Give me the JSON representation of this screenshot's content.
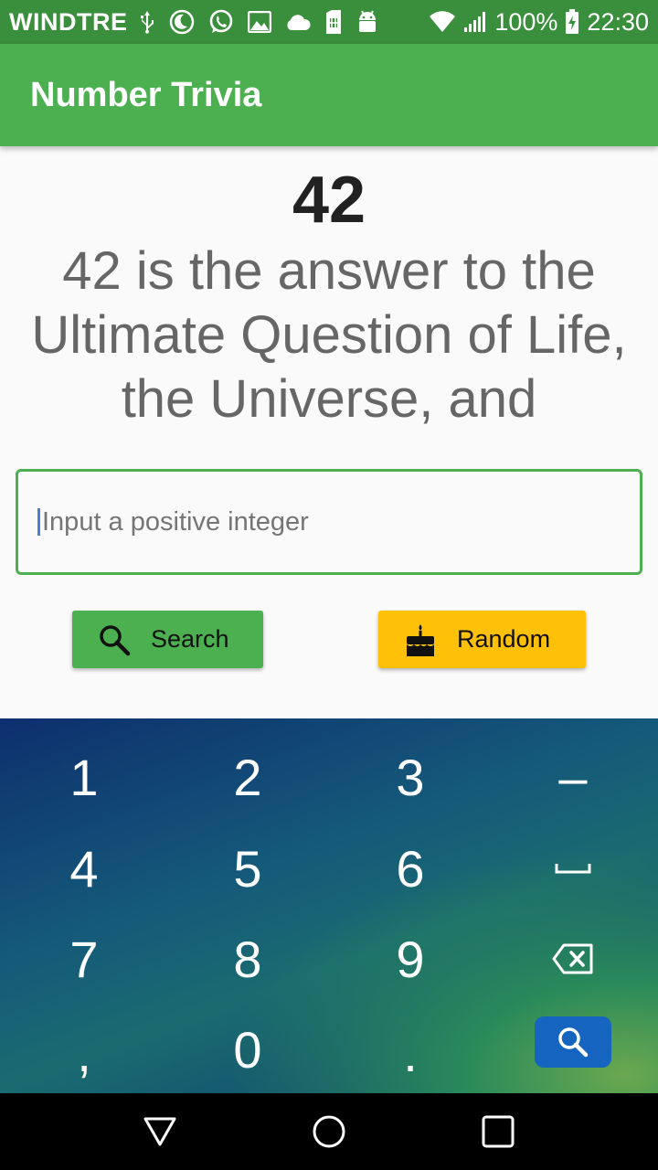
{
  "status_bar": {
    "carrier": "WINDTRE",
    "battery": "100%",
    "time": "22:30"
  },
  "app_bar": {
    "title": "Number Trivia"
  },
  "content": {
    "number": "42",
    "trivia": "42 is the answer to the Ultimate Question of Life, the Universe, and",
    "input_placeholder": "Input a positive integer"
  },
  "buttons": {
    "search_label": "Search",
    "random_label": "Random"
  },
  "keyboard": {
    "keys": [
      "1",
      "2",
      "3",
      "–",
      "4",
      "5",
      "6",
      "␣",
      "7",
      "8",
      "9",
      "⌫",
      ",",
      "0",
      "."
    ]
  },
  "colors": {
    "primary": "#4caf50",
    "primary_dark": "#3a8f3c",
    "accent": "#ffc107",
    "keyboard_action": "#1565c0"
  }
}
